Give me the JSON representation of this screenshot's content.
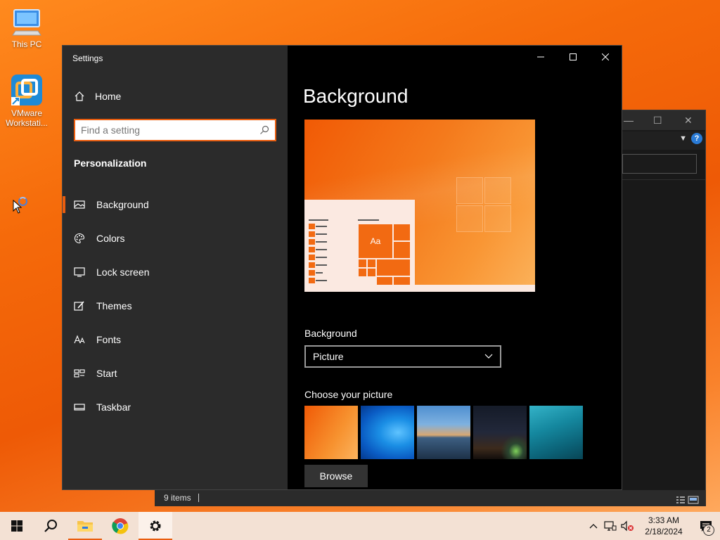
{
  "desktop": {
    "icons": [
      {
        "label": "This PC"
      },
      {
        "label": "VMware Workstati..."
      }
    ]
  },
  "settings": {
    "window_title": "Settings",
    "home_label": "Home",
    "search_placeholder": "Find a setting",
    "section_title": "Personalization",
    "nav": [
      {
        "label": "Background",
        "icon": "picture-icon",
        "active": true
      },
      {
        "label": "Colors",
        "icon": "palette-icon"
      },
      {
        "label": "Lock screen",
        "icon": "lock-screen-icon"
      },
      {
        "label": "Themes",
        "icon": "themes-brush-icon"
      },
      {
        "label": "Fonts",
        "icon": "fonts-icon"
      },
      {
        "label": "Start",
        "icon": "start-grid-icon"
      },
      {
        "label": "Taskbar",
        "icon": "taskbar-icon"
      }
    ],
    "page_title": "Background",
    "preview_tile_text": "Aa",
    "background_label": "Background",
    "background_value": "Picture",
    "choose_label": "Choose your picture",
    "browse_label": "Browse"
  },
  "explorer": {
    "status_items": "9 items"
  },
  "taskbar": {
    "time": "3:33 AM",
    "date": "2/18/2024",
    "notification_count": "2"
  },
  "colors": {
    "accent": "#e95d0f"
  }
}
